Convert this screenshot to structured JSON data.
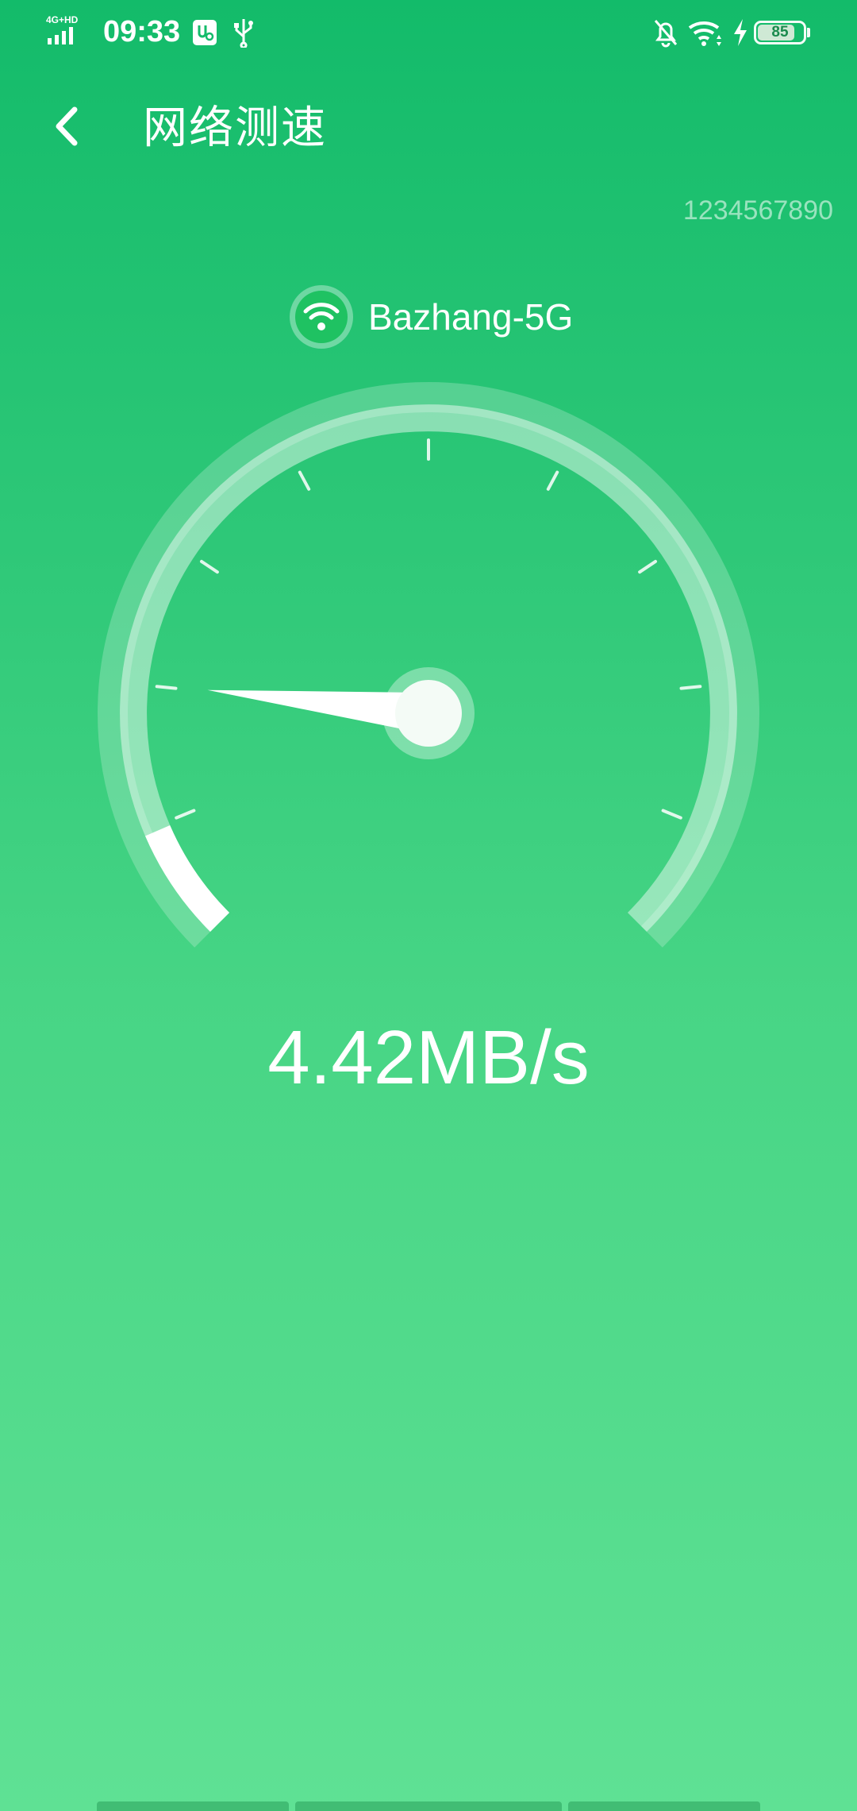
{
  "status_bar": {
    "network_type": "4G+HD",
    "time": "09:33",
    "battery": "85",
    "battery_level": 0.85
  },
  "header": {
    "back_icon": "chevron-left-icon",
    "title": "网络测速"
  },
  "number_readout": "1234567890",
  "network": {
    "icon": "wifi-icon",
    "name": "Bazhang-5G"
  },
  "gauge": {
    "progress": 0.08,
    "needle_angle_deg": 174,
    "tick_count": 9
  },
  "speed": "4.42MB/s",
  "colors": {
    "background_top": "#13bb6a",
    "background_bottom": "#5fe194",
    "accent": "#ffffff",
    "badge_green": "#1fc262"
  }
}
